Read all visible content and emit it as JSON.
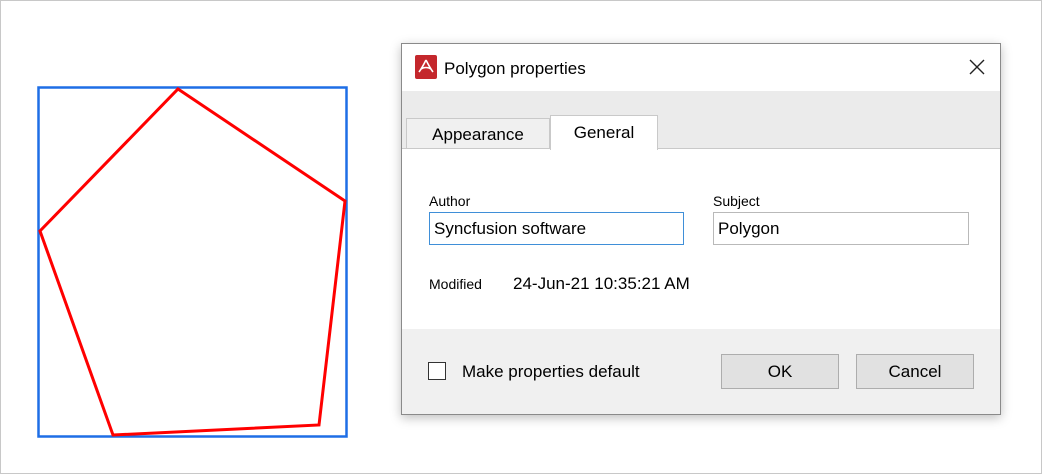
{
  "dialog": {
    "title": "Polygon properties",
    "app_icon": "pdf-viewer-icon",
    "close_icon": "close-icon"
  },
  "tabs": [
    {
      "label": "Appearance",
      "active": false
    },
    {
      "label": "General",
      "active": true
    }
  ],
  "general": {
    "author_label": "Author",
    "author_value": "Syncfusion software",
    "subject_label": "Subject",
    "subject_value": "Polygon",
    "modified_label": "Modified",
    "modified_value": "24-Jun-21 10:35:21 AM"
  },
  "footer": {
    "checkbox_label": "Make properties default",
    "checkbox_checked": false,
    "ok_label": "OK",
    "cancel_label": "Cancel"
  },
  "colors": {
    "selection_border": "#1e6ee6",
    "polygon_stroke": "#ff0000",
    "focus_border": "#3f8fd8"
  }
}
